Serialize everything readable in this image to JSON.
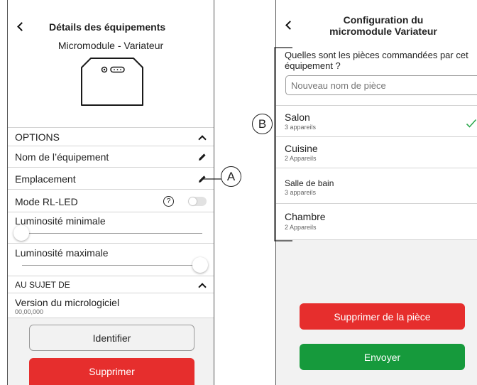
{
  "left": {
    "header_title": "Détails des équipements",
    "subtitle": "Micromodule - Variateur",
    "options_header": "OPTIONS",
    "device_name_label": "Nom de l’équipement",
    "location_label": "Emplacement",
    "rl_led_label": "Mode RL-LED",
    "help_glyph": "?",
    "min_brightness_label": "Luminosité minimale",
    "min_brightness_value": 0.0,
    "max_brightness_label": "Luminosité maximale",
    "max_brightness_value": 1.0,
    "about_header": "AU SUJET DE",
    "firmware_label": "Version du micrologiciel",
    "firmware_value": "00,00,000",
    "identify_button": "Identifier",
    "delete_button": "Supprimer"
  },
  "right": {
    "header_title_line1": "Configuration du",
    "header_title_line2": "micromodule Variateur",
    "question_line1": "Quelles sont les pièces commandées par cet",
    "question_line2": "équipement ?",
    "room_input_placeholder": "Nouveau nom de pièce",
    "rooms": [
      {
        "name": "Salon",
        "count": "3 appareils",
        "selected": true
      },
      {
        "name": "Cuisine",
        "count": "2 Appareils",
        "selected": false
      },
      {
        "name": "Salle de bain",
        "count": "3 appareils",
        "selected": false
      },
      {
        "name": "Chambre",
        "count": "2 Appareils",
        "selected": false
      }
    ],
    "remove_button": "Supprimer de la pièce",
    "send_button": "Envoyer"
  },
  "callouts": {
    "a": "A",
    "b": "B"
  },
  "colors": {
    "red": "#e62e2d",
    "green": "#169a3c",
    "check": "#2fa84f"
  }
}
